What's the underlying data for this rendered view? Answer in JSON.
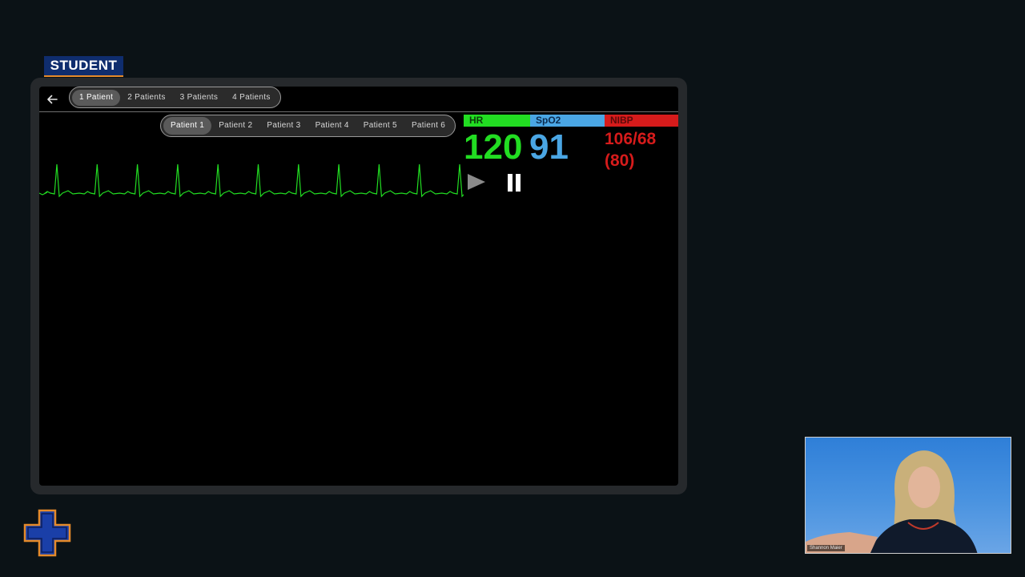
{
  "badge": {
    "label": "STUDENT"
  },
  "patient_count_tabs": [
    {
      "label": "1 Patient",
      "active": true
    },
    {
      "label": "2 Patients",
      "active": false
    },
    {
      "label": "3 Patients",
      "active": false
    },
    {
      "label": "4 Patients",
      "active": false
    }
  ],
  "patient_tabs": [
    {
      "label": "Patient 1",
      "active": true
    },
    {
      "label": "Patient 2",
      "active": false
    },
    {
      "label": "Patient 3",
      "active": false
    },
    {
      "label": "Patient 4",
      "active": false
    },
    {
      "label": "Patient 5",
      "active": false
    },
    {
      "label": "Patient 6",
      "active": false
    }
  ],
  "vitals": {
    "hr": {
      "label": "HR",
      "value": "120",
      "color": "#22dd22"
    },
    "spo2": {
      "label": "SpO2",
      "value": "91",
      "color": "#4aa6e4"
    },
    "nibp": {
      "label": "NIBP",
      "value": "106/68",
      "mean": "(80)",
      "color": "#d61b1b"
    }
  },
  "controls": {
    "play_icon": "play-icon",
    "pause_icon": "pause-icon"
  },
  "webcam": {
    "name_tag": "Shannon Maier"
  },
  "colors": {
    "ecg": "#22dd22",
    "badge_bg": "#0f2d6e",
    "badge_accent": "#e58a2a",
    "logo_fill": "#1a3fa8",
    "logo_outline": "#e58a2a"
  }
}
